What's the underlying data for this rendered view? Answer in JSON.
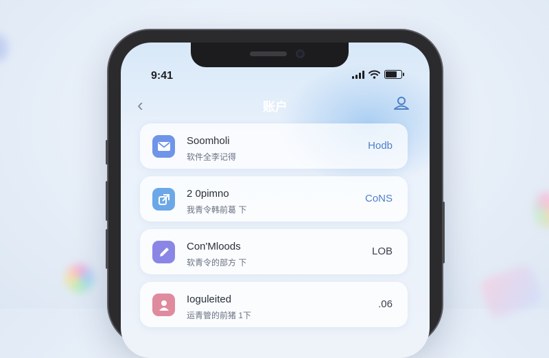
{
  "status": {
    "time": "9:41",
    "battery_level": 0.8
  },
  "nav": {
    "back_label": "‹",
    "title": "账户"
  },
  "items": [
    {
      "title": "Soomholi",
      "subtitle": "软件全李记得",
      "value": "Hodb",
      "icon": "mail-icon",
      "icon_color": "#6f95e8",
      "value_color": "#4f7fc8"
    },
    {
      "title": "2 0pimno",
      "subtitle": "我青令韩前葛   下",
      "value": "CoNS",
      "icon": "share-icon",
      "icon_color": "#6ca8e8",
      "value_color": "#4f7fc8"
    },
    {
      "title": "Con'Mloods",
      "subtitle": "软青令的部方  下",
      "value": "LOB",
      "icon": "edit-icon",
      "icon_color": "#8a86e6",
      "value_color": "#3a3f4a"
    },
    {
      "title": "Ioguleited",
      "subtitle": "运青管的前猪   1下",
      "value": ".06",
      "icon": "user-icon",
      "icon_color": "#e08a9e",
      "value_color": "#3a3f4a"
    }
  ]
}
